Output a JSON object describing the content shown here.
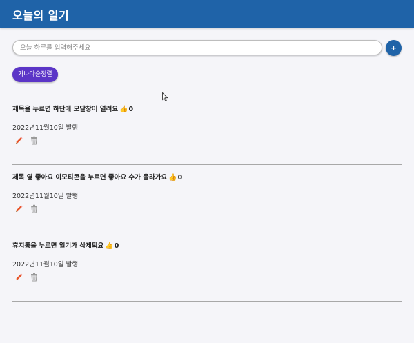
{
  "header": {
    "title": "오늘의 일기"
  },
  "input": {
    "placeholder": "오늘 하루를 입력해주세요",
    "value": ""
  },
  "add_button": {
    "label": "+"
  },
  "sort_button": {
    "label": "가나다순정렬"
  },
  "diaries": [
    {
      "title": "제목을 누르면 하단에 모달창이 열려요",
      "like_count": "0",
      "date": "2022년11월10일 발행"
    },
    {
      "title": "제목 옆 좋아요 이모티콘을 누르면 좋아요 수가 올라가요",
      "like_count": "0",
      "date": "2022년11월10일 발행"
    },
    {
      "title": "휴지통을 누르면 일기가 삭제되요",
      "like_count": "0",
      "date": "2022년11월10일 발행"
    }
  ],
  "icons": {
    "like": "thumbs-up-icon",
    "edit": "pencil-icon",
    "delete": "trash-icon"
  },
  "colors": {
    "header": "#1f63a8",
    "add_button": "#1f63a8",
    "sort_button": "#5b35c7",
    "like_icon": "#f2c230",
    "edit_icon": "#e8552b"
  }
}
